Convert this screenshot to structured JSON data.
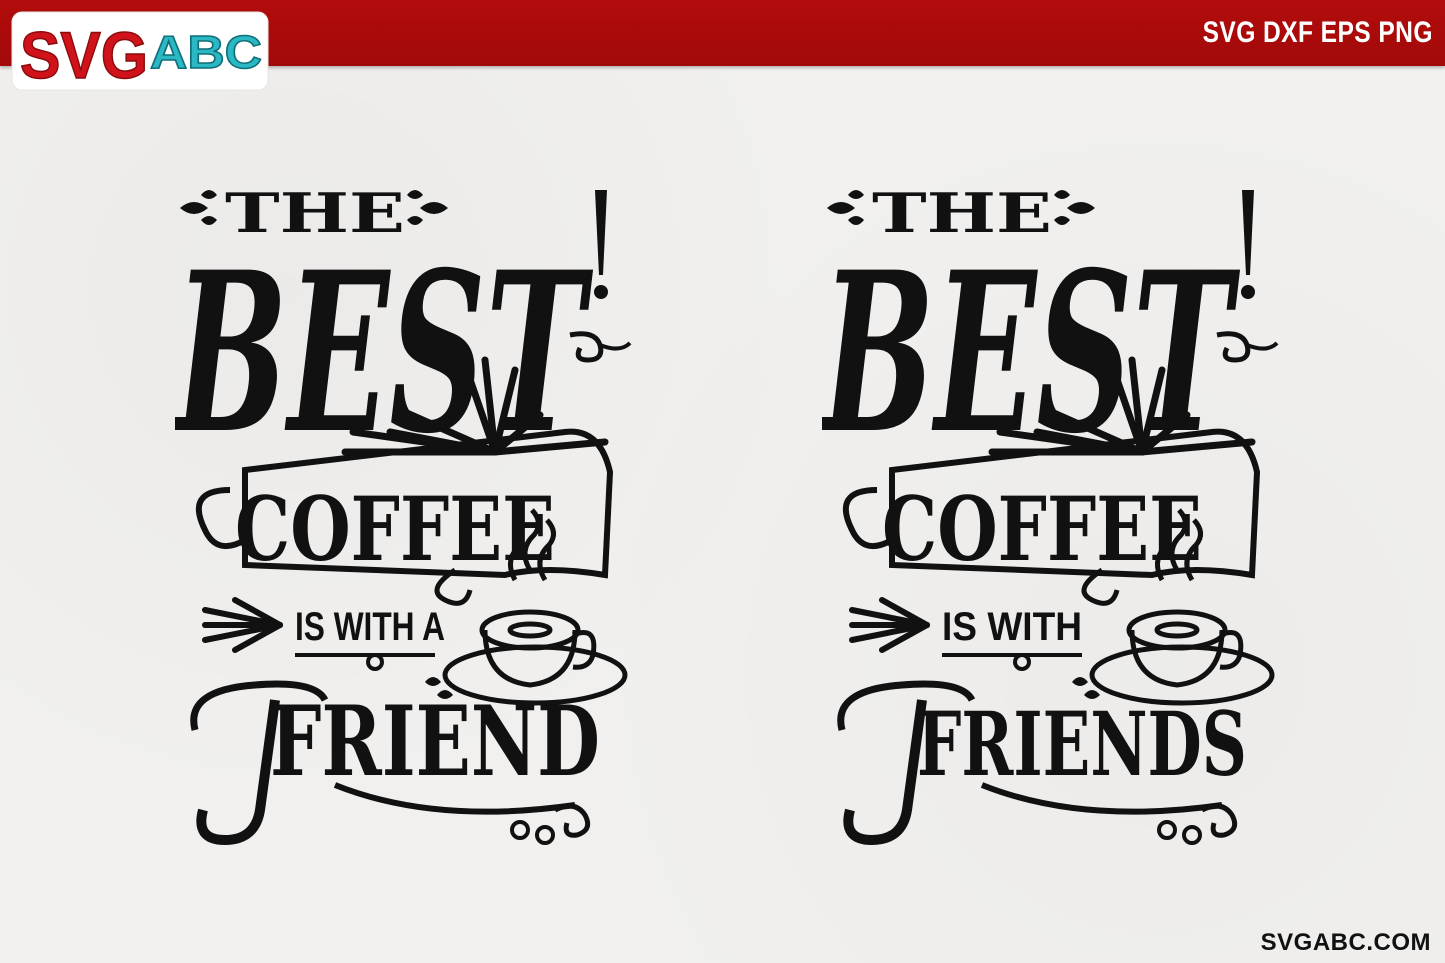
{
  "header": {
    "logo_part1": "SVG",
    "logo_part2": "ABC",
    "formats": "SVG DXF EPS PNG"
  },
  "footer": {
    "site_url": "SVGABC.COM"
  },
  "designs": [
    {
      "line1": "THE",
      "line2": "BEST",
      "line3": "COFFEE",
      "line4": "IS WITH A",
      "line5": "FRIEND"
    },
    {
      "line1": "THE",
      "line2": "BEST",
      "line3": "COFFEE",
      "line4": "IS WITH",
      "line5": "FRIENDS"
    }
  ],
  "colors": {
    "header_red": "#a10909",
    "logo_teal": "#2bb7c4",
    "ink": "#111111",
    "paper": "#f1f0ee"
  }
}
